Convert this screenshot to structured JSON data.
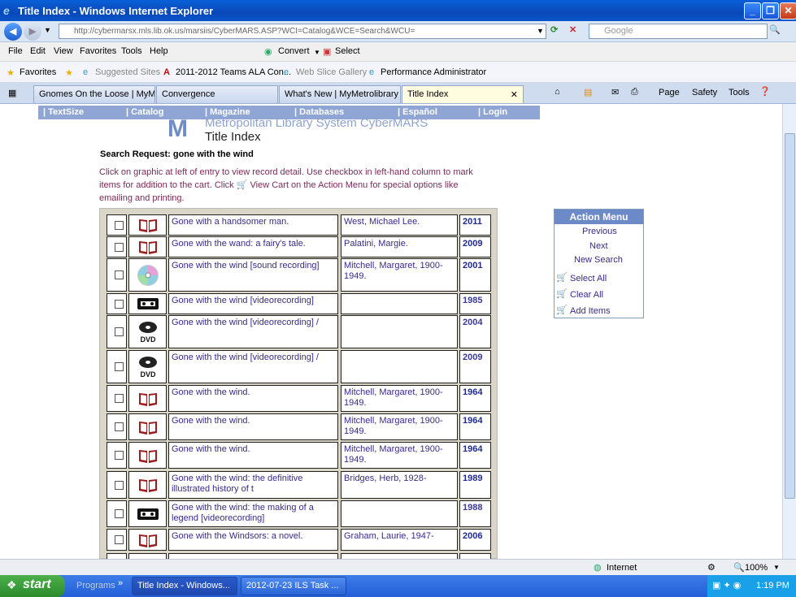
{
  "window": {
    "title": "Title Index - Windows Internet Explorer"
  },
  "address": {
    "url": "http://cybermarsx.mls.lib.ok.us/marsiis/CyberMARS.ASP?WCI=Catalog&WCE=Search&WCU=",
    "search_placeholder": "Google"
  },
  "menubar": {
    "items": [
      "File",
      "Edit",
      "View",
      "Favorites",
      "Tools",
      "Help"
    ],
    "convert": "Convert",
    "select": "Select"
  },
  "favbar": {
    "favorites": "Favorites",
    "items": [
      "Suggested Sites",
      "2011-2012 Teams  ALA Con...",
      "Web Slice Gallery",
      "Performance Administrator"
    ]
  },
  "tabs": [
    {
      "label": "Gnomes On the Loose | MyM..."
    },
    {
      "label": "Convergence"
    },
    {
      "label": "What's New | MyMetrolibrary"
    },
    {
      "label": "Title Index"
    }
  ],
  "commandbar": {
    "page": "Page",
    "safety": "Safety",
    "tools": "Tools"
  },
  "sitenav": [
    "| TextSize",
    "| Catalog",
    "| Magazine",
    "| Databases",
    "| Español",
    "| Login"
  ],
  "header": {
    "library": "Metropolitan Library System CyberMARS",
    "title": "Title Index"
  },
  "search_request": "Search Request: gone with the wind",
  "instructions": {
    "line1": "Click on graphic at left of entry to view record detail. Use checkbox in left-hand column to mark",
    "line2a": "items for addition to the cart. Click",
    "line2b": "View Cart on the Action Menu for special options like",
    "line3": "emailing and printing."
  },
  "results": [
    {
      "icon": "book",
      "title": "Gone with a handsomer man.",
      "author": "West, Michael Lee.",
      "year": "2011",
      "yearBold": true
    },
    {
      "icon": "book",
      "title": "Gone with the wand: a fairy's tale.",
      "author": "Palatini, Margie.",
      "year": "2009",
      "yearBold": true
    },
    {
      "icon": "cd",
      "title": "Gone with the wind [sound recording]",
      "author": "Mitchell, Margaret, 1900-1949.",
      "year": "2001",
      "yearBold": true
    },
    {
      "icon": "vhs",
      "title": "Gone with the wind [videorecording]",
      "author": "",
      "year": "1985",
      "yearBold": false
    },
    {
      "icon": "dvd",
      "title": "Gone with the wind [videorecording] /",
      "author": "",
      "year": "2004",
      "yearBold": false
    },
    {
      "icon": "dvd",
      "title": "Gone with the wind [videorecording] /",
      "author": "",
      "year": "2009",
      "yearBold": false
    },
    {
      "icon": "book",
      "title": "Gone with the wind.",
      "author": "Mitchell, Margaret, 1900-1949.",
      "year": "1964",
      "yearBold": true
    },
    {
      "icon": "book",
      "title": "Gone with the wind.",
      "author": "Mitchell, Margaret, 1900-1949.",
      "year": "1964",
      "yearBold": true
    },
    {
      "icon": "book",
      "title": "Gone with the wind.",
      "author": "Mitchell, Margaret, 1900-1949.",
      "year": "1964",
      "yearBold": true
    },
    {
      "icon": "book",
      "title": "Gone with the wind: the definitive illustrated history of t",
      "author": "Bridges, Herb, 1928-",
      "year": "1989",
      "yearBold": true
    },
    {
      "icon": "vhs",
      "title": "Gone with the wind: the making of a legend [videorecording]",
      "author": "",
      "year": "1988",
      "yearBold": false
    },
    {
      "icon": "book",
      "title": "Gone with the Windsors: a novel.",
      "author": "Graham, Laurie, 1947-",
      "year": "2006",
      "yearBold": true
    }
  ],
  "action_menu": {
    "header": "Action Menu",
    "previous": "Previous",
    "next": "Next",
    "new_search": "New Search",
    "select_all": "Select All",
    "clear_all": "Clear All",
    "add_items": "Add Items"
  },
  "statusbar": {
    "zone": "Internet",
    "zoom": "100%"
  },
  "taskbar": {
    "start": "start",
    "programs": "Programs",
    "tasks": [
      "Title Index - Windows...",
      "2012-07-23 ILS Task ..."
    ],
    "time": "1:19 PM"
  }
}
